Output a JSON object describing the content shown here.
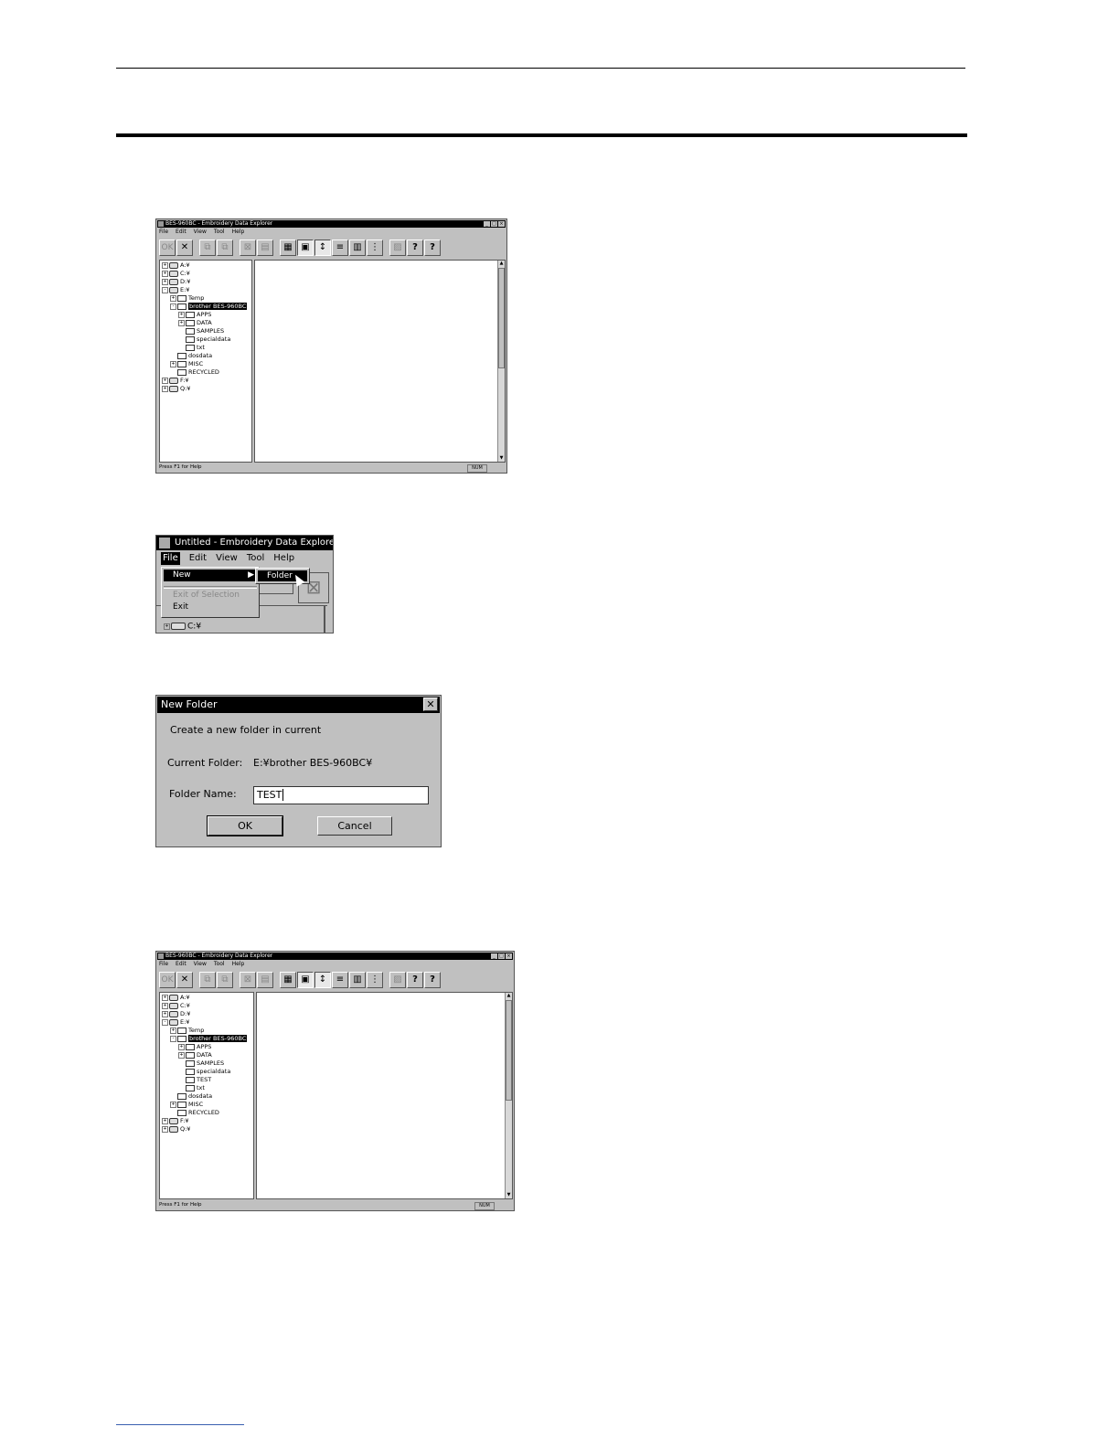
{
  "explorer1": {
    "title": "BES-960BC - Embroidery Data Explorer",
    "menus": [
      "File",
      "Edit",
      "View",
      "Tool",
      "Help"
    ],
    "toolbar": {
      "ok": "OK",
      "delete": "✕",
      "copy": "⧉",
      "paste": "⧉",
      "cut": "⊠",
      "b6": "▤",
      "list": "▦",
      "icons": "▣",
      "sort_az": "↕",
      "b10": "≡",
      "b11": "▥",
      "b12": "⋮",
      "b13": "▨",
      "help": "?",
      "context_help": "?"
    },
    "tree": [
      {
        "label": "A:¥",
        "level": 0,
        "pm": "+",
        "drive": true
      },
      {
        "label": "C:¥",
        "level": 0,
        "pm": "+",
        "drive": true
      },
      {
        "label": "D:¥",
        "level": 0,
        "pm": "+",
        "drive": true
      },
      {
        "label": "E:¥",
        "level": 0,
        "pm": "-",
        "drive": true
      },
      {
        "label": "Temp",
        "level": 1,
        "pm": "+"
      },
      {
        "label": "brother BES-960BC",
        "level": 1,
        "pm": "-",
        "selected": true
      },
      {
        "label": "APPS",
        "level": 2,
        "pm": "+"
      },
      {
        "label": "DATA",
        "level": 2,
        "pm": "+"
      },
      {
        "label": "SAMPLES",
        "level": 2
      },
      {
        "label": "specialdata",
        "level": 2
      },
      {
        "label": "txt",
        "level": 2
      },
      {
        "label": "dosdata",
        "level": 1
      },
      {
        "label": "MISC",
        "level": 1,
        "pm": "+"
      },
      {
        "label": "RECYCLED",
        "level": 1
      },
      {
        "label": "F:¥",
        "level": 0,
        "pm": "+",
        "drive": true
      },
      {
        "label": "Q:¥",
        "level": 0,
        "pm": "+",
        "drive": true
      }
    ],
    "status": "Press F1 for Help",
    "status_num": "NUM"
  },
  "menu_shot": {
    "title": "Untitled - Embroidery Data Explorer",
    "menus": [
      "File",
      "Edit",
      "View",
      "Tool",
      "Help"
    ],
    "file_menu": {
      "new": "New",
      "exit_of_selection": "Exit of Selection",
      "exit": "Exit"
    },
    "submenu_folder": "Folder",
    "tree_item": "C:¥"
  },
  "dialog": {
    "title": "New Folder",
    "close": "✕",
    "message": "Create a new folder in current",
    "current_folder_label": "Current Folder:",
    "current_folder_value": "E:¥brother BES-960BC¥",
    "folder_name_label": "Folder Name:",
    "folder_name_value": "TEST",
    "ok": "OK",
    "cancel": "Cancel"
  },
  "explorer2": {
    "title": "BES-960BC - Embroidery Data Explorer",
    "menus": [
      "File",
      "Edit",
      "View",
      "Tool",
      "Help"
    ],
    "tree": [
      {
        "label": "A:¥",
        "level": 0,
        "pm": "+",
        "drive": true
      },
      {
        "label": "C:¥",
        "level": 0,
        "pm": "+",
        "drive": true
      },
      {
        "label": "D:¥",
        "level": 0,
        "pm": "+",
        "drive": true
      },
      {
        "label": "E:¥",
        "level": 0,
        "pm": "-",
        "drive": true
      },
      {
        "label": "Temp",
        "level": 1,
        "pm": "+"
      },
      {
        "label": "brother BES-960BC",
        "level": 1,
        "pm": "-",
        "selected": true
      },
      {
        "label": "APPS",
        "level": 2,
        "pm": "+"
      },
      {
        "label": "DATA",
        "level": 2,
        "pm": "+"
      },
      {
        "label": "SAMPLES",
        "level": 2
      },
      {
        "label": "specialdata",
        "level": 2
      },
      {
        "label": "TEST",
        "level": 2
      },
      {
        "label": "txt",
        "level": 2
      },
      {
        "label": "dosdata",
        "level": 1
      },
      {
        "label": "MISC",
        "level": 1,
        "pm": "+"
      },
      {
        "label": "RECYCLED",
        "level": 1
      },
      {
        "label": "F:¥",
        "level": 0,
        "pm": "+",
        "drive": true
      },
      {
        "label": "Q:¥",
        "level": 0,
        "pm": "+",
        "drive": true
      }
    ],
    "status": "Press F1 for Help",
    "status_num": "NUM"
  }
}
